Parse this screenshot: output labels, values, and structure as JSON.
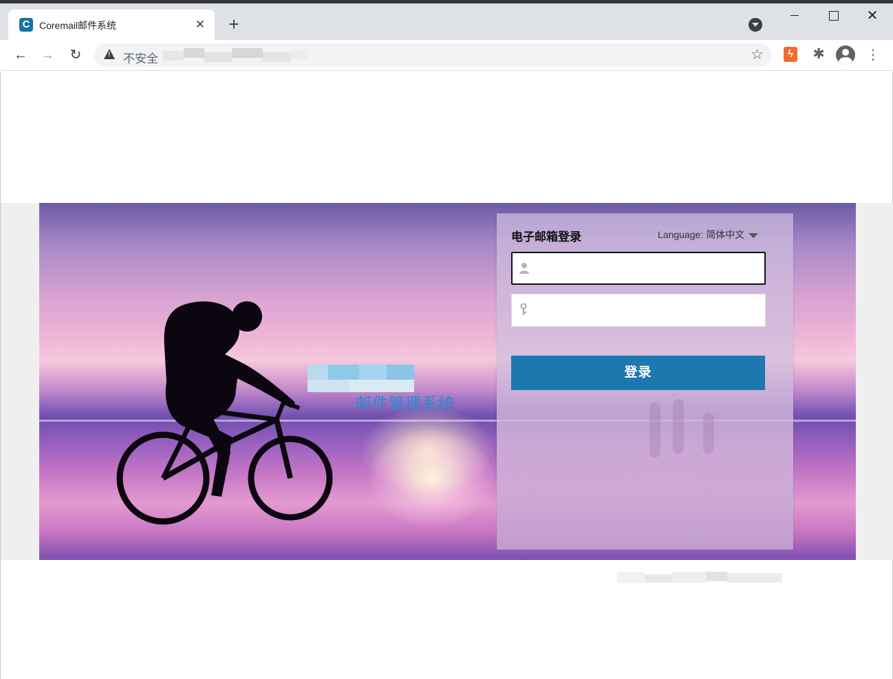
{
  "browser": {
    "tab": {
      "title": "Coremail邮件系统",
      "favicon_letter": "C",
      "close_icon": "close-icon"
    },
    "new_tab_symbol": "+",
    "window_controls": [
      "minimize-icon",
      "maximize-icon",
      "close-icon"
    ],
    "toolbar": {
      "back_symbol": "←",
      "forward_symbol": "→",
      "reload_symbol": "↻",
      "security_label": "不安全",
      "bookmark_symbol": "☆",
      "extension_symbol": "ϟ",
      "puzzle_symbol": "✱",
      "menu_symbol": "⋮"
    }
  },
  "hero": {
    "subtitle": "邮件管理系统"
  },
  "login": {
    "title": "电子邮箱登录",
    "language_label": "Language:",
    "language_value": "简体中文",
    "username_placeholder": "",
    "password_placeholder": "",
    "submit_label": "登录"
  },
  "colors": {
    "brand_blue": "#1c78ae",
    "subtitle_blue": "#1f8fd6",
    "panel_bg": "#cebede",
    "chrome_bg": "#dee1e6"
  }
}
